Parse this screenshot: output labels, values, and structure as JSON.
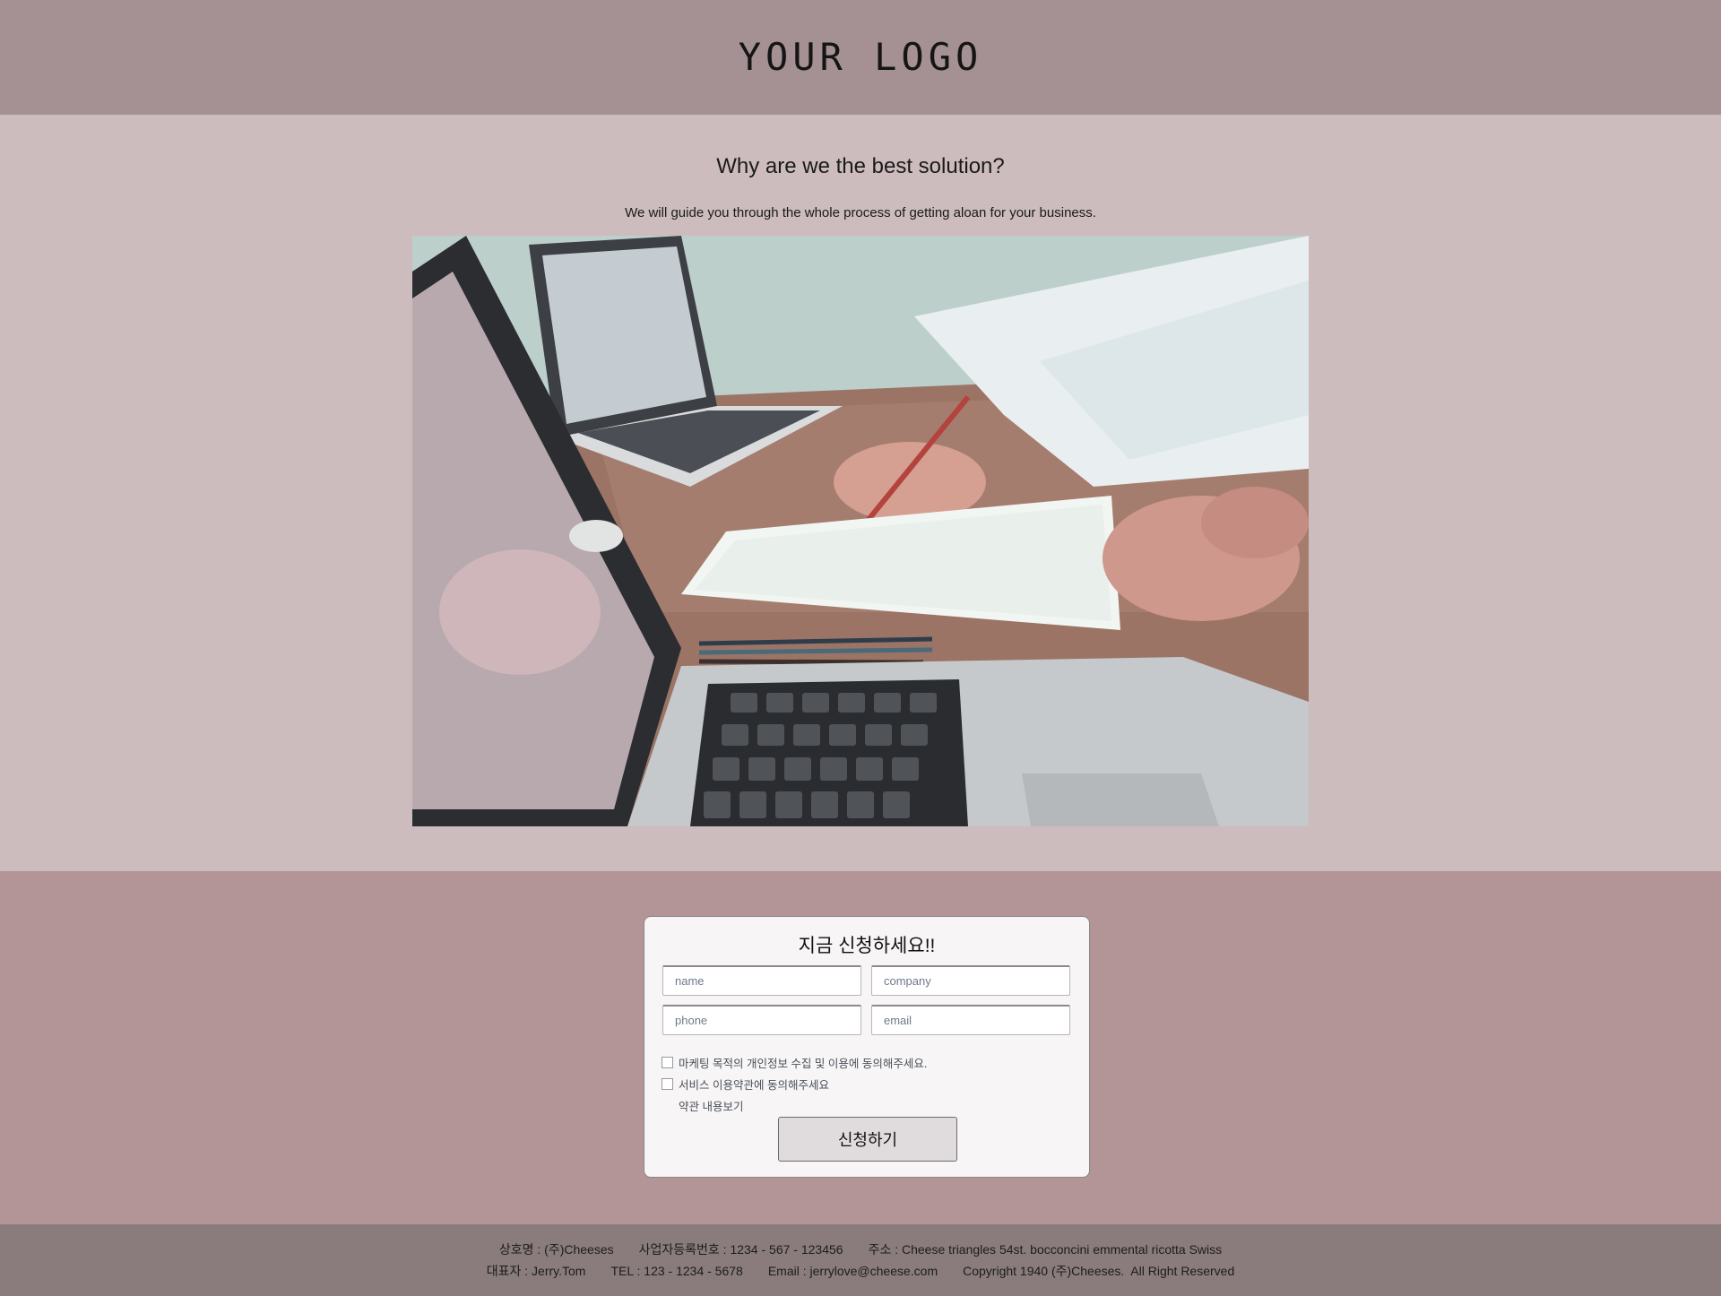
{
  "header": {
    "logo_text": "YOUR LOGO"
  },
  "hero": {
    "title": "Why are we the best solution?",
    "subtitle": "We will guide you through the whole process of getting aloan for your business."
  },
  "form": {
    "title": "지금 신청하세요!!",
    "fields": {
      "name_placeholder": "name",
      "company_placeholder": "company",
      "phone_placeholder": "phone",
      "email_placeholder": "email"
    },
    "marketing_consent_label": "마케팅 목적의 개인정보 수집 및 이용에 동의해주세요.",
    "terms_consent_label": "서비스 이용약관에 동의해주세요",
    "terms_link": "약관 내용보기",
    "submit_label": "신청하기"
  },
  "footer": {
    "company_name": "상호명 : (주)Cheeses",
    "registration": "사업자등록번호 : 1234 - 567 - 123456",
    "address": "주소 : Cheese triangles 54st. bocconcini emmental ricotta Swiss",
    "ceo": "대표자 : Jerry.Tom",
    "tel": "TEL : 123 - 1234 - 5678",
    "email": "Email : jerrylove@cheese.com",
    "copyright": "Copyright 1940 (주)Cheeses.  All Right Reserved"
  }
}
